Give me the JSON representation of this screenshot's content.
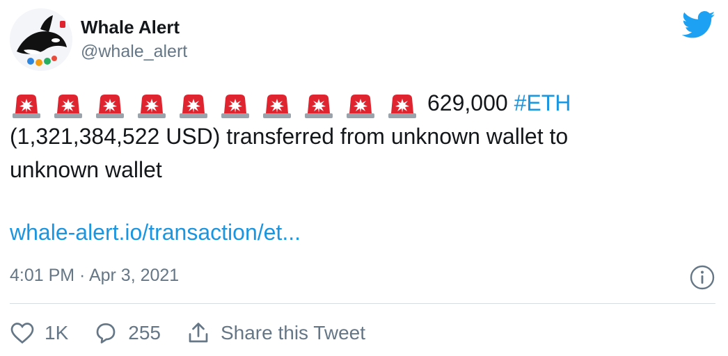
{
  "author": {
    "display_name": "Whale Alert",
    "handle": "@whale_alert",
    "avatar_icon": "whale-avatar"
  },
  "brand_icon": "twitter-bird-icon",
  "colors": {
    "link": "#1b95e0",
    "muted": "#657786",
    "text": "#14171a",
    "siren": "#e0242f",
    "brand": "#1da1f2"
  },
  "tweet": {
    "siren_icon": "police-car-light-emoji",
    "siren_count": 10,
    "amount": "629,000",
    "hashtag": "#ETH",
    "line2": "(1,321,384,522 USD) transferred from unknown wallet to",
    "line3": "unknown wallet",
    "link": "whale-alert.io/transaction/et..."
  },
  "timestamp": "4:01 PM · Apr 3, 2021",
  "actions": {
    "like_count": "1K",
    "reply_count": "255",
    "share_label": "Share this Tweet"
  }
}
